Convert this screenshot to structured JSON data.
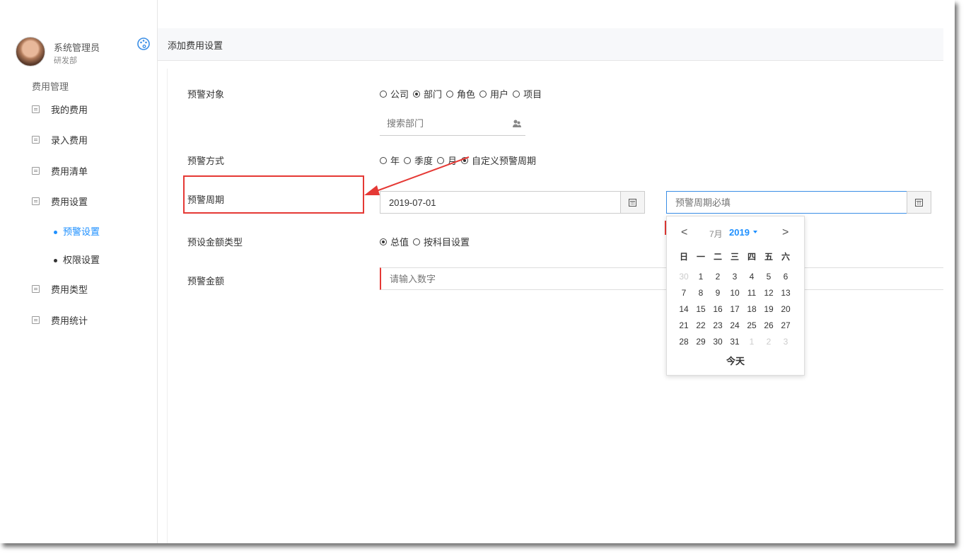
{
  "user": {
    "name": "系统管理员",
    "dept": "研发部"
  },
  "sidebar": {
    "group_title": "费用管理",
    "items": [
      {
        "label": "我的费用"
      },
      {
        "label": "录入费用"
      },
      {
        "label": "费用清单"
      },
      {
        "label": "费用设置"
      },
      {
        "label": "费用类型"
      },
      {
        "label": "费用统计"
      }
    ],
    "subitems": [
      {
        "label": "预警设置",
        "active": true
      },
      {
        "label": "权限设置",
        "active": false
      }
    ]
  },
  "header": {
    "title": "添加费用设置"
  },
  "form": {
    "target": {
      "label": "预警对象",
      "options": [
        "公司",
        "部门",
        "角色",
        "用户",
        "项目"
      ],
      "selected": "部门"
    },
    "search": {
      "placeholder": "搜索部门"
    },
    "mode": {
      "label": "预警方式",
      "options": [
        "年",
        "季度",
        "月",
        "自定义预警周期"
      ],
      "selected": "自定义预警周期"
    },
    "period": {
      "label": "预警周期",
      "start_value": "2019-07-01",
      "end_placeholder": "预警周期必填"
    },
    "amount_type": {
      "label": "预设金额类型",
      "options": [
        "总值",
        "按科目设置"
      ],
      "selected": "总值"
    },
    "amount": {
      "label": "预警金额",
      "placeholder": "请输入数字"
    }
  },
  "calendar": {
    "prev": "<",
    "next": ">",
    "month": "7月",
    "year": "2019",
    "weekdays": [
      "日",
      "一",
      "二",
      "三",
      "四",
      "五",
      "六"
    ],
    "weeks": [
      [
        "30",
        "1",
        "2",
        "3",
        "4",
        "5",
        "6"
      ],
      [
        "7",
        "8",
        "9",
        "10",
        "11",
        "12",
        "13"
      ],
      [
        "14",
        "15",
        "16",
        "17",
        "18",
        "19",
        "20"
      ],
      [
        "21",
        "22",
        "23",
        "24",
        "25",
        "26",
        "27"
      ],
      [
        "28",
        "29",
        "30",
        "31",
        "1",
        "2",
        "3"
      ]
    ],
    "today_label": "今天"
  },
  "colors": {
    "accent": "#1e90ff",
    "highlight": "#e53935"
  }
}
